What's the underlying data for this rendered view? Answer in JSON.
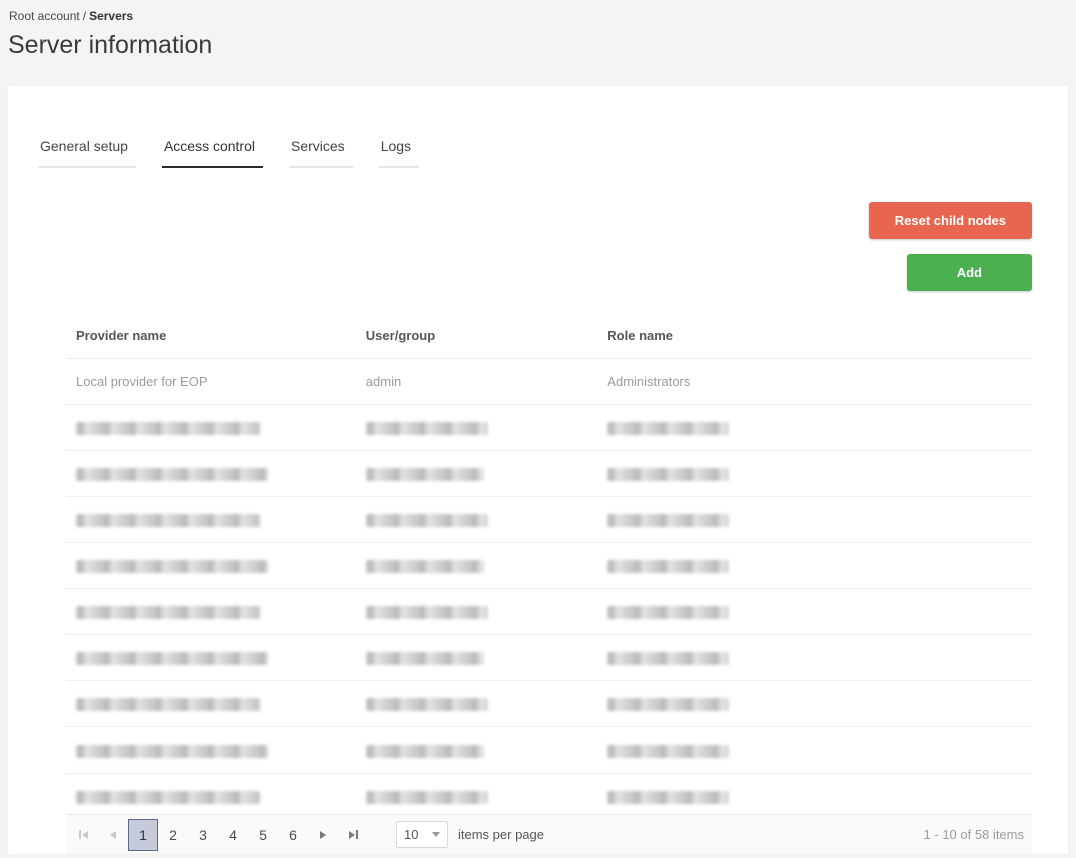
{
  "breadcrumb": {
    "root": "Root account",
    "separator": "/",
    "current": "Servers"
  },
  "page_title": "Server information",
  "tabs": [
    {
      "label": "General setup",
      "active": false
    },
    {
      "label": "Access control",
      "active": true
    },
    {
      "label": "Services",
      "active": false
    },
    {
      "label": "Logs",
      "active": false
    }
  ],
  "actions": {
    "reset_label": "Reset child nodes",
    "add_label": "Add"
  },
  "colors": {
    "reset_button": "#e8664f",
    "add_button": "#4caf50",
    "active_tab_underline": "#2b2b2b",
    "pager_active_bg": "#c6cbdc"
  },
  "table": {
    "headers": [
      "Provider name",
      "User/group",
      "Role name"
    ],
    "rows": [
      {
        "redacted": false,
        "provider": "Local provider for EOP",
        "user": "admin",
        "role": "Administrators"
      },
      {
        "redacted": true
      },
      {
        "redacted": true
      },
      {
        "redacted": true
      },
      {
        "redacted": true
      },
      {
        "redacted": true
      },
      {
        "redacted": true
      },
      {
        "redacted": true
      },
      {
        "redacted": true
      },
      {
        "redacted": true
      }
    ]
  },
  "pagination": {
    "pages": [
      "1",
      "2",
      "3",
      "4",
      "5",
      "6"
    ],
    "current_page": "1",
    "page_size": "10",
    "items_per_page_label": "items per page",
    "range_label": "1 - 10 of 58 items"
  }
}
